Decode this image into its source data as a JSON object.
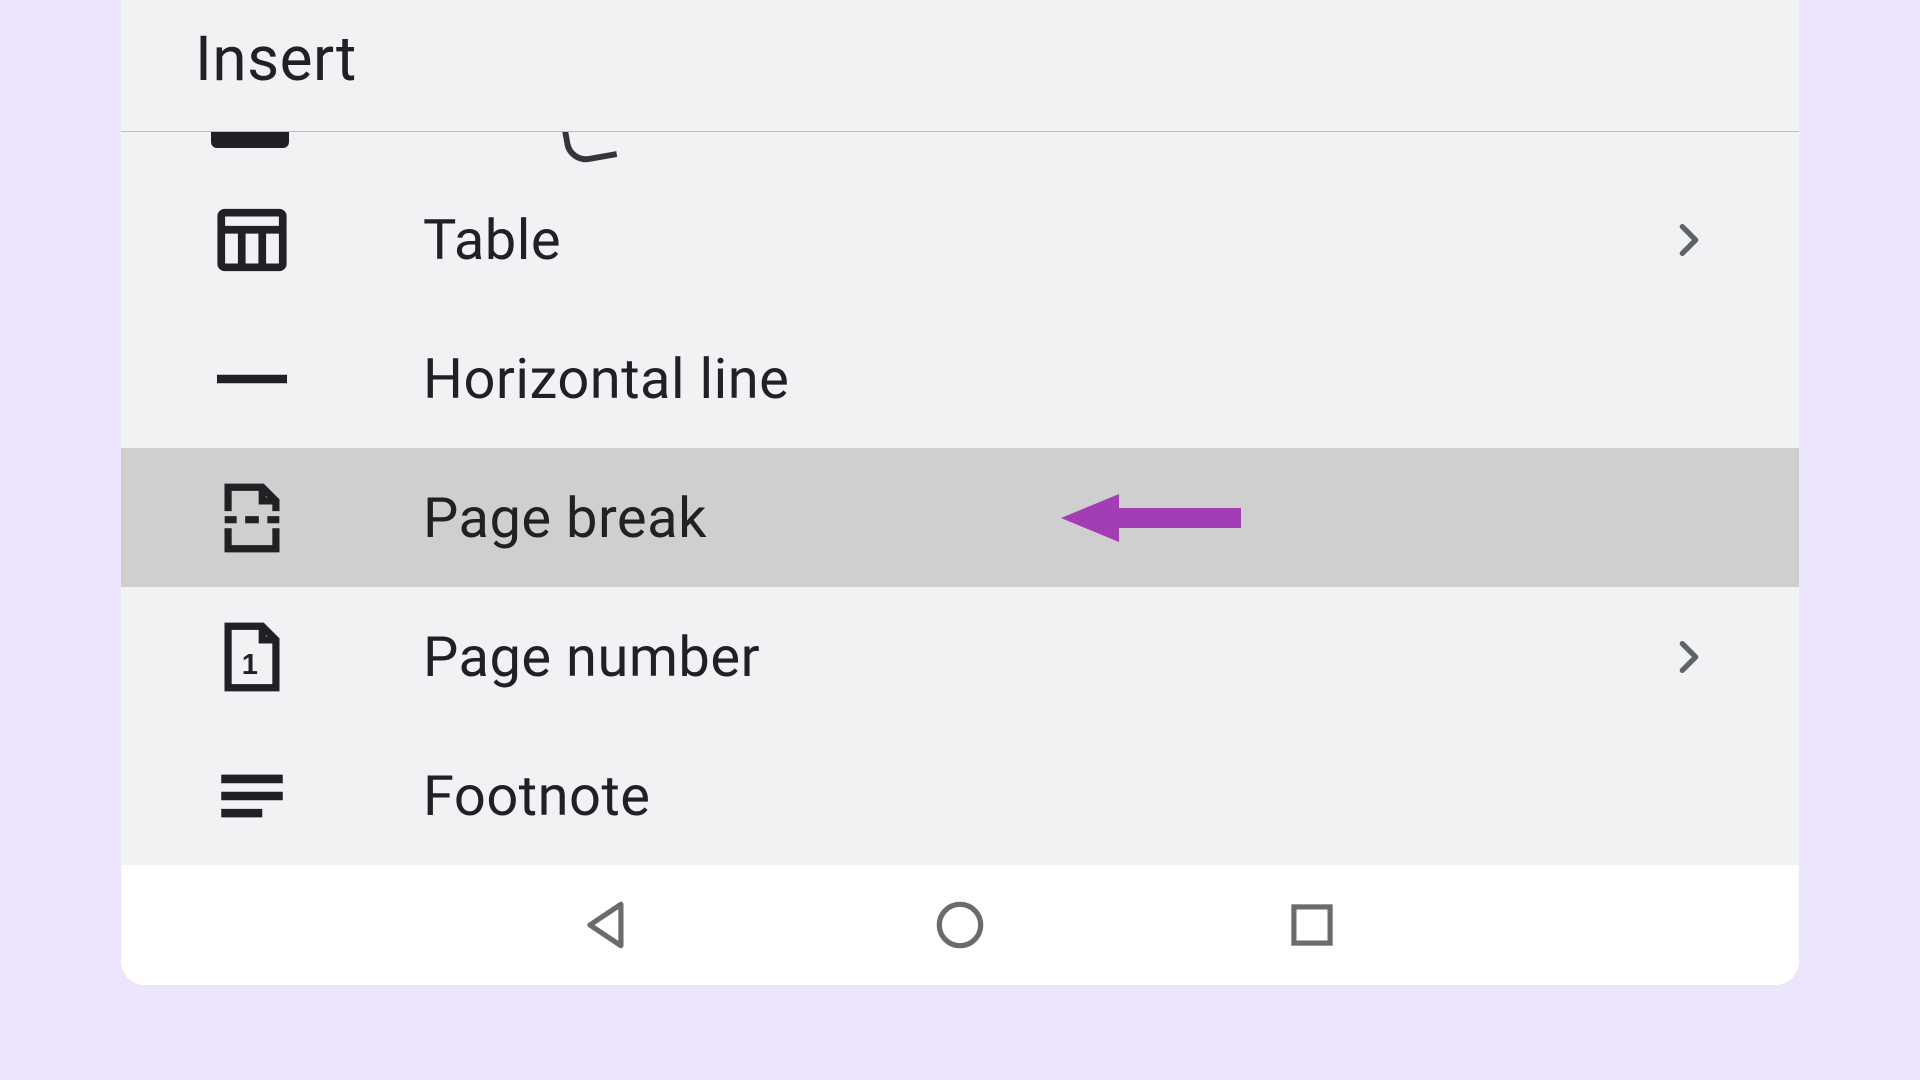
{
  "panel": {
    "title": "Insert"
  },
  "menu": {
    "items": [
      {
        "label": "Table",
        "icon": "table-icon",
        "has_submenu": true,
        "highlighted": false
      },
      {
        "label": "Horizontal line",
        "icon": "horizontal-line-icon",
        "has_submenu": false,
        "highlighted": false
      },
      {
        "label": "Page break",
        "icon": "page-break-icon",
        "has_submenu": false,
        "highlighted": true
      },
      {
        "label": "Page number",
        "icon": "page-number-icon",
        "has_submenu": true,
        "highlighted": false
      },
      {
        "label": "Footnote",
        "icon": "footnote-icon",
        "has_submenu": false,
        "highlighted": false
      }
    ]
  },
  "annotation": {
    "target_item_index": 2,
    "arrow_color": "#a23db5"
  },
  "nav": {
    "buttons": [
      "back",
      "home",
      "recents"
    ]
  }
}
